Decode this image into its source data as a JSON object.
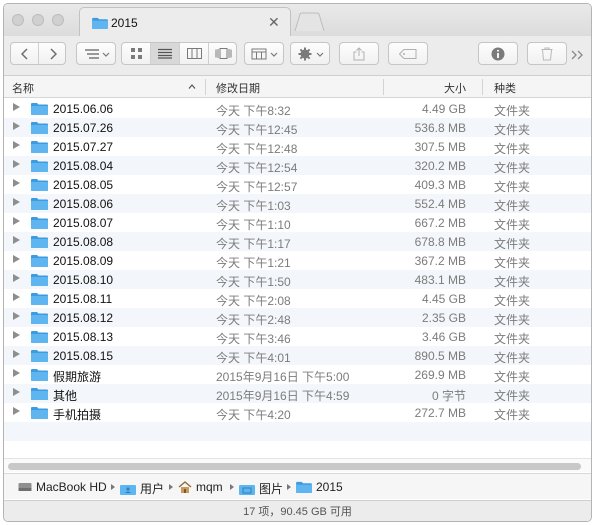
{
  "window": {
    "tab_title": "2015"
  },
  "toolbar": {
    "buttons": [
      "back",
      "forward",
      "arrange",
      "icon-view",
      "list-view",
      "column-view",
      "coverflow-view",
      "group",
      "action",
      "share",
      "tags",
      "info",
      "delete",
      "overflow"
    ]
  },
  "columns": {
    "name": "名称",
    "date": "修改日期",
    "size": "大小",
    "kind": "种类"
  },
  "rows": [
    {
      "name": "2015.06.06",
      "date": "今天 下午8:32",
      "size": "4.49 GB",
      "kind": "文件夹"
    },
    {
      "name": "2015.07.26",
      "date": "今天 下午12:45",
      "size": "536.8 MB",
      "kind": "文件夹"
    },
    {
      "name": "2015.07.27",
      "date": "今天 下午12:48",
      "size": "307.5 MB",
      "kind": "文件夹"
    },
    {
      "name": "2015.08.04",
      "date": "今天 下午12:54",
      "size": "320.2 MB",
      "kind": "文件夹"
    },
    {
      "name": "2015.08.05",
      "date": "今天 下午12:57",
      "size": "409.3 MB",
      "kind": "文件夹"
    },
    {
      "name": "2015.08.06",
      "date": "今天 下午1:03",
      "size": "552.4 MB",
      "kind": "文件夹"
    },
    {
      "name": "2015.08.07",
      "date": "今天 下午1:10",
      "size": "667.2 MB",
      "kind": "文件夹"
    },
    {
      "name": "2015.08.08",
      "date": "今天 下午1:17",
      "size": "678.8 MB",
      "kind": "文件夹"
    },
    {
      "name": "2015.08.09",
      "date": "今天 下午1:21",
      "size": "367.2 MB",
      "kind": "文件夹"
    },
    {
      "name": "2015.08.10",
      "date": "今天 下午1:50",
      "size": "483.1 MB",
      "kind": "文件夹"
    },
    {
      "name": "2015.08.11",
      "date": "今天 下午2:08",
      "size": "4.45 GB",
      "kind": "文件夹"
    },
    {
      "name": "2015.08.12",
      "date": "今天 下午2:48",
      "size": "2.35 GB",
      "kind": "文件夹"
    },
    {
      "name": "2015.08.13",
      "date": "今天 下午3:46",
      "size": "3.46 GB",
      "kind": "文件夹"
    },
    {
      "name": "2015.08.15",
      "date": "今天 下午4:01",
      "size": "890.5 MB",
      "kind": "文件夹"
    },
    {
      "name": "假期旅游",
      "date": "2015年9月16日 下午5:00",
      "size": "269.9 MB",
      "kind": "文件夹"
    },
    {
      "name": "其他",
      "date": "2015年9月16日 下午4:59",
      "size": "0 字节",
      "kind": "文件夹"
    },
    {
      "name": "手机拍摄",
      "date": "今天 下午4:20",
      "size": "272.7 MB",
      "kind": "文件夹"
    }
  ],
  "path": [
    "MacBook HD",
    "用户",
    "mqm",
    "图片",
    "2015"
  ],
  "status": "17 项，90.45 GB 可用",
  "colors": {
    "folder": "#5fb5ef",
    "folder_dark": "#3d9be0",
    "stripe": "#f3f6fa"
  }
}
